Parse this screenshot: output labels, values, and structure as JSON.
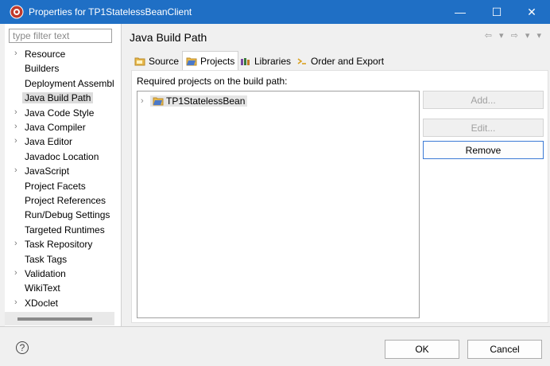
{
  "window": {
    "title": "Properties for TP1StatelessBeanClient",
    "minimize_glyph": "—",
    "maximize_glyph": "☐",
    "close_glyph": "✕"
  },
  "filter": {
    "placeholder": "type filter text",
    "value": ""
  },
  "tree": {
    "items": [
      {
        "label": "Resource",
        "expandable": true,
        "selected": false
      },
      {
        "label": "Builders",
        "expandable": false,
        "selected": false
      },
      {
        "label": "Deployment Assembl",
        "expandable": false,
        "selected": false
      },
      {
        "label": "Java Build Path",
        "expandable": false,
        "selected": true
      },
      {
        "label": "Java Code Style",
        "expandable": true,
        "selected": false
      },
      {
        "label": "Java Compiler",
        "expandable": true,
        "selected": false
      },
      {
        "label": "Java Editor",
        "expandable": true,
        "selected": false
      },
      {
        "label": "Javadoc Location",
        "expandable": false,
        "selected": false
      },
      {
        "label": "JavaScript",
        "expandable": true,
        "selected": false
      },
      {
        "label": "Project Facets",
        "expandable": false,
        "selected": false
      },
      {
        "label": "Project References",
        "expandable": false,
        "selected": false
      },
      {
        "label": "Run/Debug Settings",
        "expandable": false,
        "selected": false
      },
      {
        "label": "Targeted Runtimes",
        "expandable": false,
        "selected": false
      },
      {
        "label": "Task Repository",
        "expandable": true,
        "selected": false
      },
      {
        "label": "Task Tags",
        "expandable": false,
        "selected": false
      },
      {
        "label": "Validation",
        "expandable": true,
        "selected": false
      },
      {
        "label": "WikiText",
        "expandable": false,
        "selected": false
      },
      {
        "label": "XDoclet",
        "expandable": true,
        "selected": false
      }
    ]
  },
  "page": {
    "title": "Java Build Path",
    "nav_glyphs": "⇦ ▾ ⇨ ▾ ▾"
  },
  "tabs": [
    {
      "label": "Source",
      "icon": "source-folder-icon",
      "active": false
    },
    {
      "label": "Projects",
      "icon": "projects-icon",
      "active": true
    },
    {
      "label": "Libraries",
      "icon": "libraries-icon",
      "active": false
    },
    {
      "label": "Order and Export",
      "icon": "order-export-icon",
      "active": false
    }
  ],
  "projects": {
    "label": "Required projects on the build path:",
    "items": [
      {
        "name": "TP1StatelessBean"
      }
    ]
  },
  "buttons": {
    "add": "Add...",
    "edit": "Edit...",
    "remove": "Remove"
  },
  "dialog": {
    "ok": "OK",
    "cancel": "Cancel",
    "help_glyph": "?"
  },
  "colors": {
    "titlebar": "#1f6fc5",
    "accent": "#3b7ad5"
  }
}
